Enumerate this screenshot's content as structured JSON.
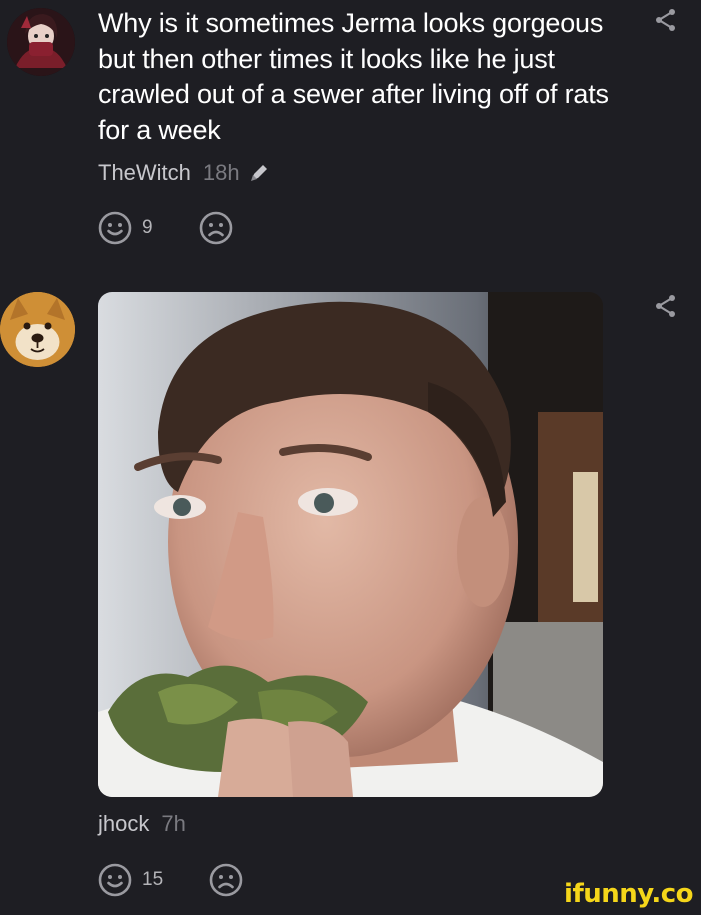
{
  "comments": [
    {
      "text": "Why is it sometimes Jerma looks gorgeous but then other times it looks like he just crawled out of a sewer after living off of rats for a week",
      "username": "TheWitch",
      "time": "18h",
      "smile_count": "9",
      "avatar_icon": "witch-avatar",
      "edited_icon": "pencil-icon"
    },
    {
      "username": "jhock",
      "time": "7h",
      "smile_count": "15",
      "avatar_icon": "shiba-dog-avatar",
      "attachment": "photo of man eating leafy greens"
    }
  ],
  "watermark": "ifunny.co",
  "colors": {
    "background": "#1e1e23",
    "text": "#ffffff",
    "meta": "#8a8a90",
    "icon": "#9a9aa0",
    "watermark": "#f5d61a"
  }
}
